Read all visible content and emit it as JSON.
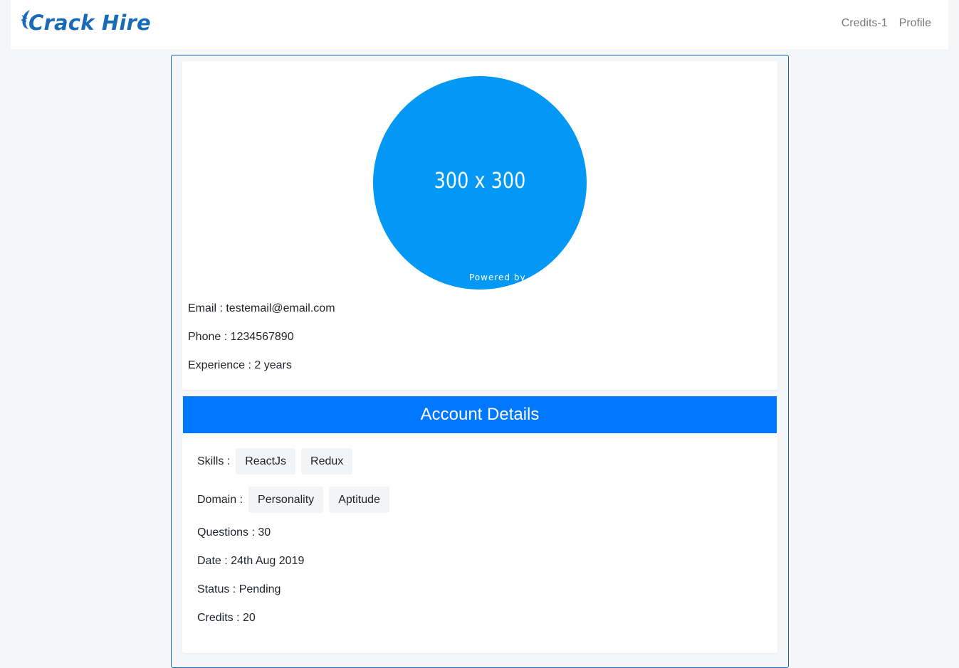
{
  "brand": {
    "name": "Crack Hire",
    "color": "#1a6bb5"
  },
  "nav": {
    "items": [
      "Credits-1",
      "Profile"
    ]
  },
  "profile": {
    "avatar_text": "300 x 300",
    "avatar_powered": "Powered by",
    "avatar_color": "#0398f6",
    "email": "Email : testemail@email.com",
    "phone": "Phone : 1234567890",
    "experience": "Experience : 2 years"
  },
  "account": {
    "title": "Account Details",
    "header_color": "#0077ff",
    "skills_label": "Skills :",
    "skills": [
      "ReactJs",
      "Redux"
    ],
    "domain_label": "Domain :",
    "domains": [
      "Personality",
      "Aptitude"
    ],
    "questions": "Questions : 30",
    "date": "Date : 24th Aug 2019",
    "status": "Status : Pending",
    "credits": "Credits : 20"
  }
}
